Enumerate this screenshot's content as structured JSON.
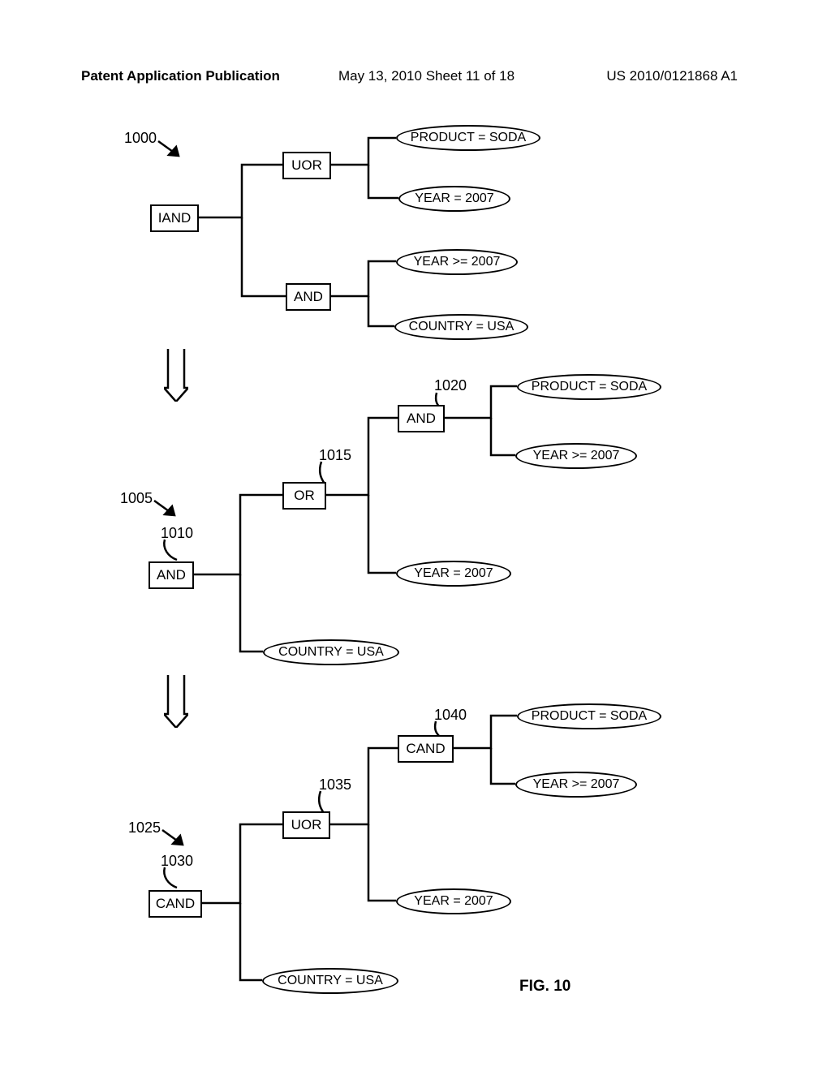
{
  "header": {
    "left": "Patent Application Publication",
    "mid": "May 13, 2010  Sheet 11 of 18",
    "right": "US 2010/0121868 A1"
  },
  "tree1": {
    "ref": "1000",
    "root": "IAND",
    "n1": "UOR",
    "n2": "AND",
    "p1": "PRODUCT = SODA",
    "p2": "YEAR = 2007",
    "p3": "YEAR >= 2007",
    "p4": "COUNTRY = USA"
  },
  "tree2": {
    "ref": "1005",
    "refRoot": "1010",
    "refMid": "1015",
    "refTop": "1020",
    "root": "AND",
    "n1": "OR",
    "n2": "AND",
    "p1": "PRODUCT = SODA",
    "p2": "YEAR >= 2007",
    "p3": "YEAR = 2007",
    "p4": "COUNTRY = USA"
  },
  "tree3": {
    "ref": "1025",
    "refRoot": "1030",
    "refMid": "1035",
    "refTop": "1040",
    "root": "CAND",
    "n1": "UOR",
    "n2": "CAND",
    "p1": "PRODUCT = SODA",
    "p2": "YEAR >= 2007",
    "p3": "YEAR = 2007",
    "p4": "COUNTRY = USA"
  },
  "figure": "FIG.  10"
}
